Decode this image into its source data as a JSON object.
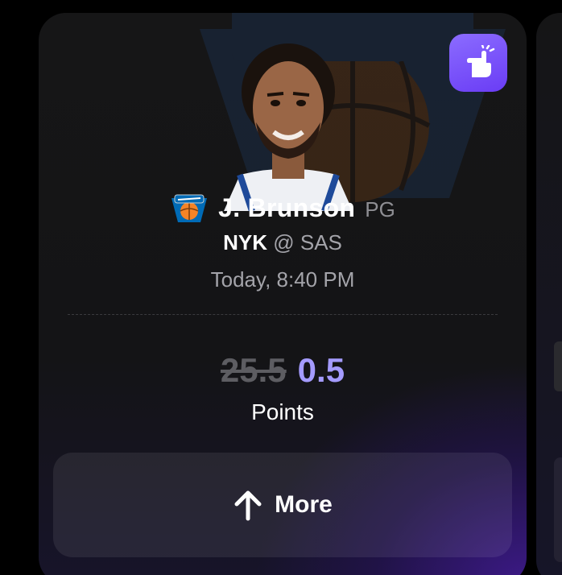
{
  "player": {
    "name": "J. Brunson",
    "position": "PG"
  },
  "game": {
    "home_team": "NYK",
    "separator": "@",
    "away_team": "SAS",
    "time": "Today, 8:40 PM"
  },
  "projection": {
    "original_line": "25.5",
    "current_line": "0.5",
    "stat": "Points"
  },
  "actions": {
    "more_label": "More"
  },
  "colors": {
    "accent": "#a49bff",
    "fav_button": "#7a52ff",
    "team_orange": "#f58426",
    "team_blue": "#006bb6"
  },
  "icons": {
    "favorite": "pointing-hand-icon",
    "more": "arrow-up-icon",
    "team": "knicks-logo-icon"
  }
}
